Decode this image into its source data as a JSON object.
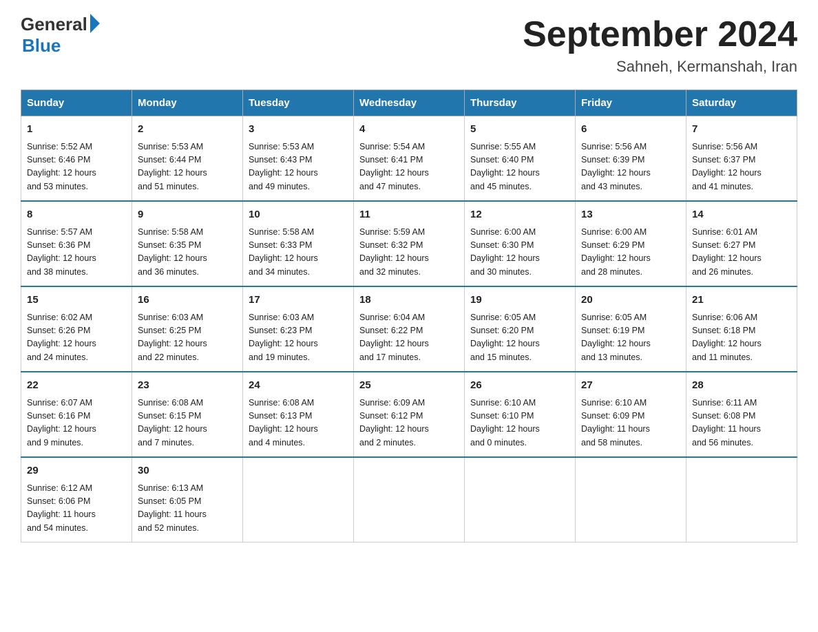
{
  "logo": {
    "general": "General",
    "blue": "Blue"
  },
  "title": "September 2024",
  "location": "Sahneh, Kermanshah, Iran",
  "days_of_week": [
    "Sunday",
    "Monday",
    "Tuesday",
    "Wednesday",
    "Thursday",
    "Friday",
    "Saturday"
  ],
  "weeks": [
    [
      {
        "day": "1",
        "sunrise": "5:52 AM",
        "sunset": "6:46 PM",
        "daylight": "12 hours and 53 minutes."
      },
      {
        "day": "2",
        "sunrise": "5:53 AM",
        "sunset": "6:44 PM",
        "daylight": "12 hours and 51 minutes."
      },
      {
        "day": "3",
        "sunrise": "5:53 AM",
        "sunset": "6:43 PM",
        "daylight": "12 hours and 49 minutes."
      },
      {
        "day": "4",
        "sunrise": "5:54 AM",
        "sunset": "6:41 PM",
        "daylight": "12 hours and 47 minutes."
      },
      {
        "day": "5",
        "sunrise": "5:55 AM",
        "sunset": "6:40 PM",
        "daylight": "12 hours and 45 minutes."
      },
      {
        "day": "6",
        "sunrise": "5:56 AM",
        "sunset": "6:39 PM",
        "daylight": "12 hours and 43 minutes."
      },
      {
        "day": "7",
        "sunrise": "5:56 AM",
        "sunset": "6:37 PM",
        "daylight": "12 hours and 41 minutes."
      }
    ],
    [
      {
        "day": "8",
        "sunrise": "5:57 AM",
        "sunset": "6:36 PM",
        "daylight": "12 hours and 38 minutes."
      },
      {
        "day": "9",
        "sunrise": "5:58 AM",
        "sunset": "6:35 PM",
        "daylight": "12 hours and 36 minutes."
      },
      {
        "day": "10",
        "sunrise": "5:58 AM",
        "sunset": "6:33 PM",
        "daylight": "12 hours and 34 minutes."
      },
      {
        "day": "11",
        "sunrise": "5:59 AM",
        "sunset": "6:32 PM",
        "daylight": "12 hours and 32 minutes."
      },
      {
        "day": "12",
        "sunrise": "6:00 AM",
        "sunset": "6:30 PM",
        "daylight": "12 hours and 30 minutes."
      },
      {
        "day": "13",
        "sunrise": "6:00 AM",
        "sunset": "6:29 PM",
        "daylight": "12 hours and 28 minutes."
      },
      {
        "day": "14",
        "sunrise": "6:01 AM",
        "sunset": "6:27 PM",
        "daylight": "12 hours and 26 minutes."
      }
    ],
    [
      {
        "day": "15",
        "sunrise": "6:02 AM",
        "sunset": "6:26 PM",
        "daylight": "12 hours and 24 minutes."
      },
      {
        "day": "16",
        "sunrise": "6:03 AM",
        "sunset": "6:25 PM",
        "daylight": "12 hours and 22 minutes."
      },
      {
        "day": "17",
        "sunrise": "6:03 AM",
        "sunset": "6:23 PM",
        "daylight": "12 hours and 19 minutes."
      },
      {
        "day": "18",
        "sunrise": "6:04 AM",
        "sunset": "6:22 PM",
        "daylight": "12 hours and 17 minutes."
      },
      {
        "day": "19",
        "sunrise": "6:05 AM",
        "sunset": "6:20 PM",
        "daylight": "12 hours and 15 minutes."
      },
      {
        "day": "20",
        "sunrise": "6:05 AM",
        "sunset": "6:19 PM",
        "daylight": "12 hours and 13 minutes."
      },
      {
        "day": "21",
        "sunrise": "6:06 AM",
        "sunset": "6:18 PM",
        "daylight": "12 hours and 11 minutes."
      }
    ],
    [
      {
        "day": "22",
        "sunrise": "6:07 AM",
        "sunset": "6:16 PM",
        "daylight": "12 hours and 9 minutes."
      },
      {
        "day": "23",
        "sunrise": "6:08 AM",
        "sunset": "6:15 PM",
        "daylight": "12 hours and 7 minutes."
      },
      {
        "day": "24",
        "sunrise": "6:08 AM",
        "sunset": "6:13 PM",
        "daylight": "12 hours and 4 minutes."
      },
      {
        "day": "25",
        "sunrise": "6:09 AM",
        "sunset": "6:12 PM",
        "daylight": "12 hours and 2 minutes."
      },
      {
        "day": "26",
        "sunrise": "6:10 AM",
        "sunset": "6:10 PM",
        "daylight": "12 hours and 0 minutes."
      },
      {
        "day": "27",
        "sunrise": "6:10 AM",
        "sunset": "6:09 PM",
        "daylight": "11 hours and 58 minutes."
      },
      {
        "day": "28",
        "sunrise": "6:11 AM",
        "sunset": "6:08 PM",
        "daylight": "11 hours and 56 minutes."
      }
    ],
    [
      {
        "day": "29",
        "sunrise": "6:12 AM",
        "sunset": "6:06 PM",
        "daylight": "11 hours and 54 minutes."
      },
      {
        "day": "30",
        "sunrise": "6:13 AM",
        "sunset": "6:05 PM",
        "daylight": "11 hours and 52 minutes."
      },
      null,
      null,
      null,
      null,
      null
    ]
  ],
  "labels": {
    "sunrise": "Sunrise:",
    "sunset": "Sunset:",
    "daylight": "Daylight:"
  }
}
